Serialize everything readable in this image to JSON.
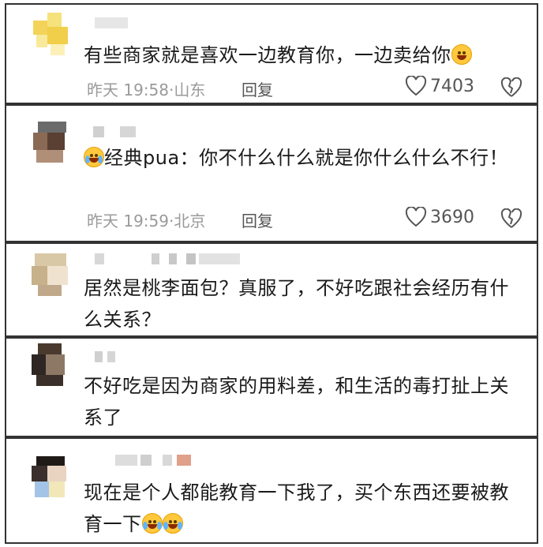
{
  "comments": [
    {
      "text": "有些商家就是喜欢一边教育你，一边卖给你",
      "emoji": "grin-sweat",
      "time": "昨天 19:58",
      "location": "山东",
      "reply": "回复",
      "likes": "7403"
    },
    {
      "text_before": "经典pua：你不什么什么就是你什么什么不行！",
      "emoji": "loud-crying",
      "time": "昨天 19:59",
      "location": "北京",
      "reply": "回复",
      "likes": "3690"
    },
    {
      "text": "居然是桃李面包？真服了，不好吃跟社会经历有什么关系？"
    },
    {
      "text": "不好吃是因为商家的用料差，和生活的毒打扯上关系了"
    },
    {
      "text": "现在是个人都能教育一下我了，买个东西还要被教育一下",
      "emoji": "tears-of-joy"
    }
  ],
  "icons": {
    "like": "heart-outline-icon",
    "dislike": "broken-heart-icon"
  },
  "colors": {
    "text": "#1a1a1a",
    "meta": "#9a9a9a",
    "border": "#333333"
  }
}
